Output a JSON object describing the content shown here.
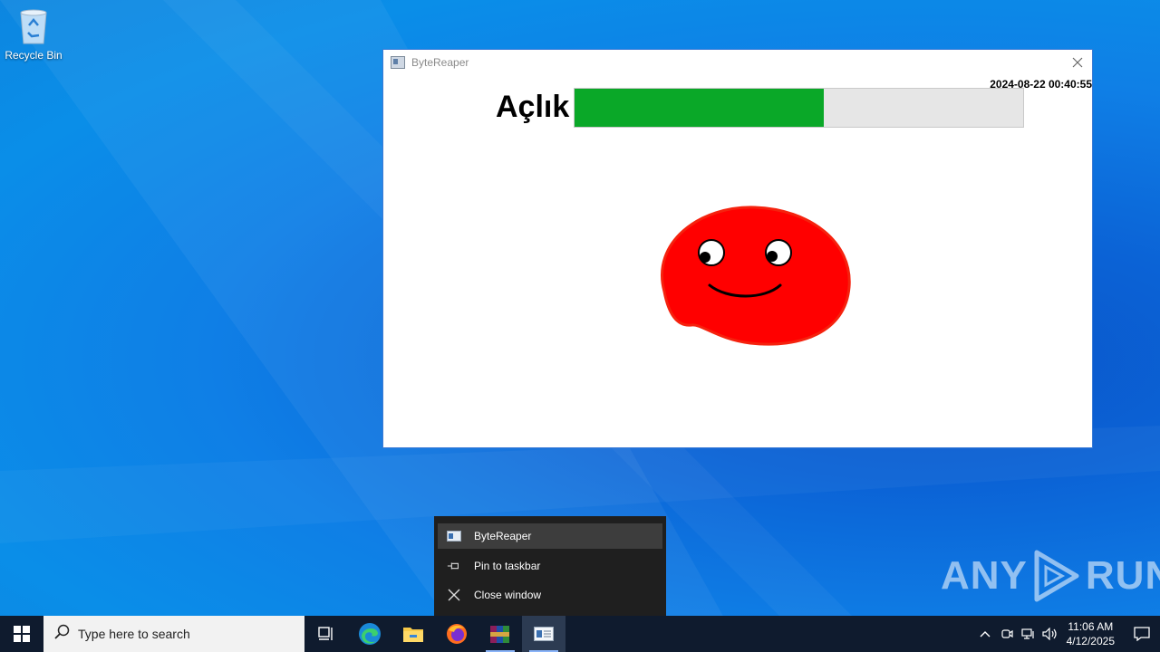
{
  "desktop": {
    "recycle_bin_label": "Recycle Bin"
  },
  "window": {
    "title": "ByteReaper",
    "timestamp": "2024-08-22 00:40:55",
    "meter_label": "Açlık",
    "meter_fraction": 0.555,
    "colors": {
      "bar_fill": "#0aa828",
      "bar_track": "#e6e6e6",
      "creature": "#ff0000"
    }
  },
  "jump_list": {
    "items": [
      {
        "label": "ByteReaper",
        "icon": "app-window-icon"
      },
      {
        "label": "Pin to taskbar",
        "icon": "pin-icon"
      },
      {
        "label": "Close window",
        "icon": "close-icon"
      }
    ]
  },
  "watermark": {
    "text_left": "ANY",
    "text_right": "RUN"
  },
  "taskbar": {
    "search_placeholder": "Type here to search",
    "clock_time": "11:06 AM",
    "clock_date": "4/12/2025"
  }
}
